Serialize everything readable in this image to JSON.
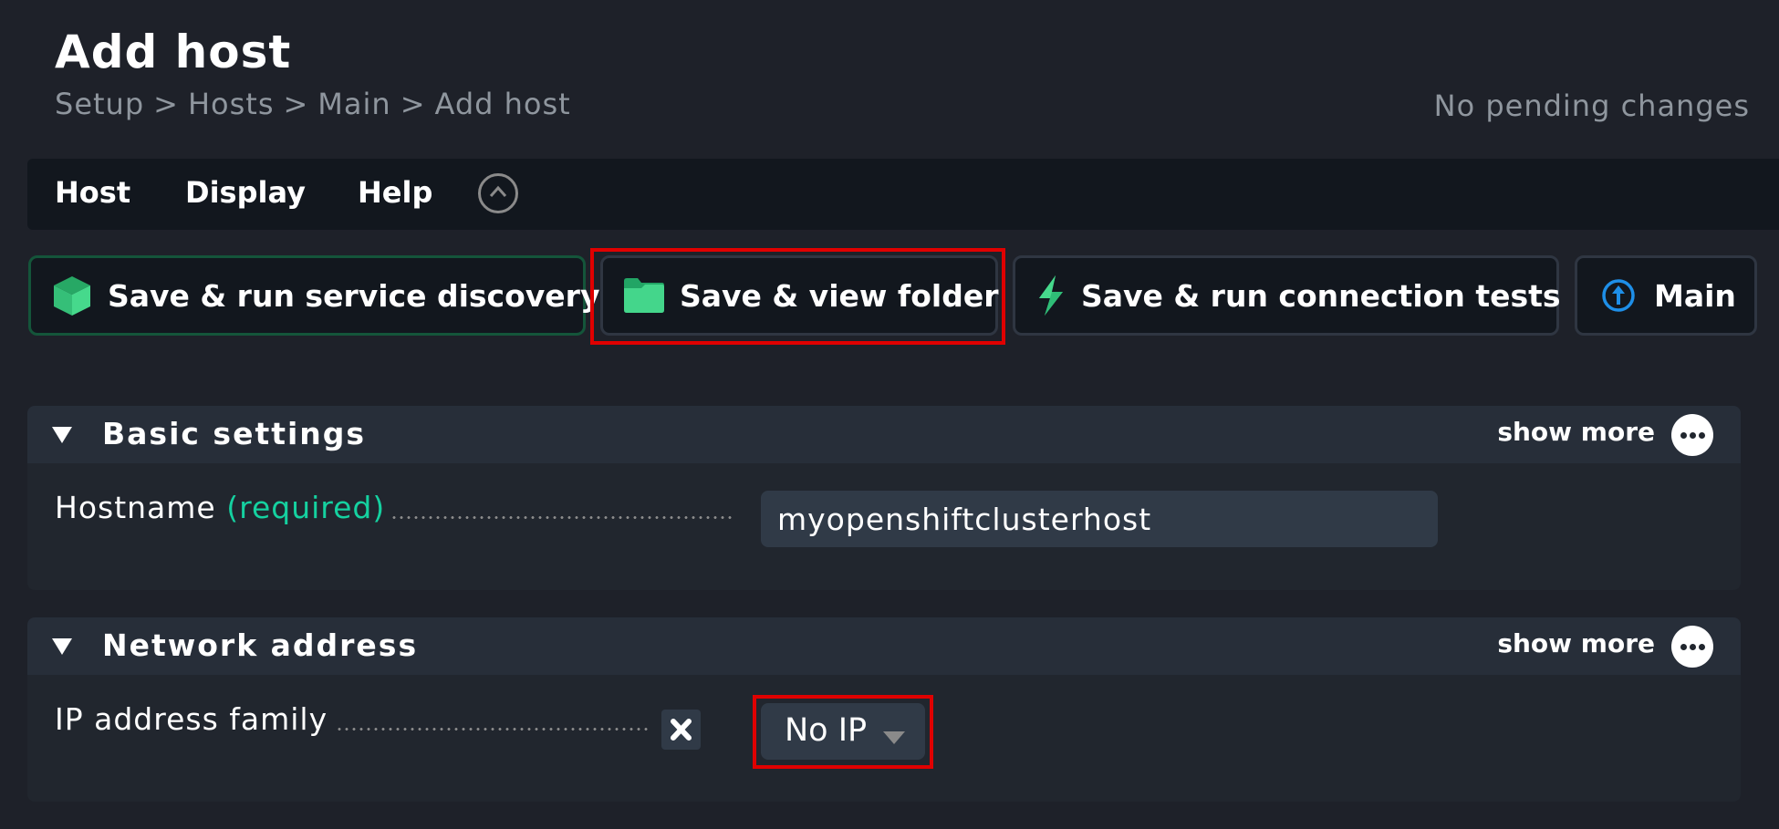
{
  "header": {
    "title": "Add host",
    "breadcrumb": [
      "Setup",
      "Hosts",
      "Main",
      "Add host"
    ],
    "breadcrumb_separator": ">",
    "pending_status": "No pending changes"
  },
  "menubar": {
    "items": [
      {
        "label": "Host"
      },
      {
        "label": "Display"
      },
      {
        "label": "Help"
      }
    ],
    "collapse_icon": "chevron-up-circle-icon"
  },
  "actions": [
    {
      "label": "Save & run service discovery",
      "icon": "cube-icon",
      "highlighted": false,
      "primary": true
    },
    {
      "label": "Save & view folder",
      "icon": "folder-icon",
      "highlighted": true,
      "primary": false
    },
    {
      "label": "Save & run connection tests",
      "icon": "lightning-icon",
      "highlighted": false,
      "primary": false
    },
    {
      "label": "Main",
      "icon": "arrow-up-circle-icon",
      "highlighted": false,
      "primary": false
    }
  ],
  "sections": [
    {
      "title": "Basic settings",
      "show_more_label": "show more",
      "fields": [
        {
          "label": "Hostname",
          "required_label": "(required)",
          "value": "myopenshiftclusterhost"
        }
      ]
    },
    {
      "title": "Network address",
      "show_more_label": "show more",
      "fields": [
        {
          "label": "IP address family",
          "value": "No IP",
          "highlighted": true
        }
      ]
    }
  ],
  "colors": {
    "background": "#1e2129",
    "accent_green": "#3fd18a",
    "required_green": "#15d1a0",
    "highlight_red": "#e00000",
    "main_icon_blue": "#1e8fe8"
  }
}
